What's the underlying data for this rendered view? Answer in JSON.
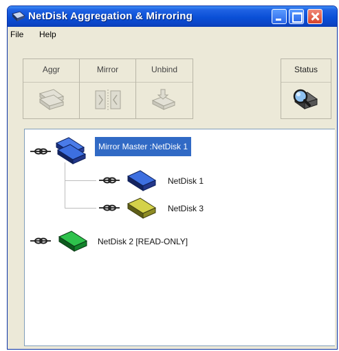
{
  "window": {
    "title": "NetDisk Aggregation & Mirroring"
  },
  "menu": {
    "file": "File",
    "help": "Help"
  },
  "toolbar": {
    "aggr_label": "Aggr",
    "mirror_label": "Mirror",
    "unbind_label": "Unbind",
    "status_label": "Status"
  },
  "tree": {
    "root_mirror": "Mirror Master :NetDisk 1",
    "child_1": "NetDisk 1",
    "child_2": "NetDisk 3",
    "root_single": "NetDisk 2  [READ-ONLY]"
  },
  "colors": {
    "disk_mirror_master": "#1f4fc4",
    "disk_1": "#2a52c9",
    "disk_3": "#c2c234",
    "disk_2": "#19a43a",
    "selection": "#316ac5"
  },
  "icons": {
    "aggr": "aggregate-icon",
    "mirror": "mirror-icon",
    "unbind": "unbind-icon",
    "status": "status-magnifier-icon"
  }
}
